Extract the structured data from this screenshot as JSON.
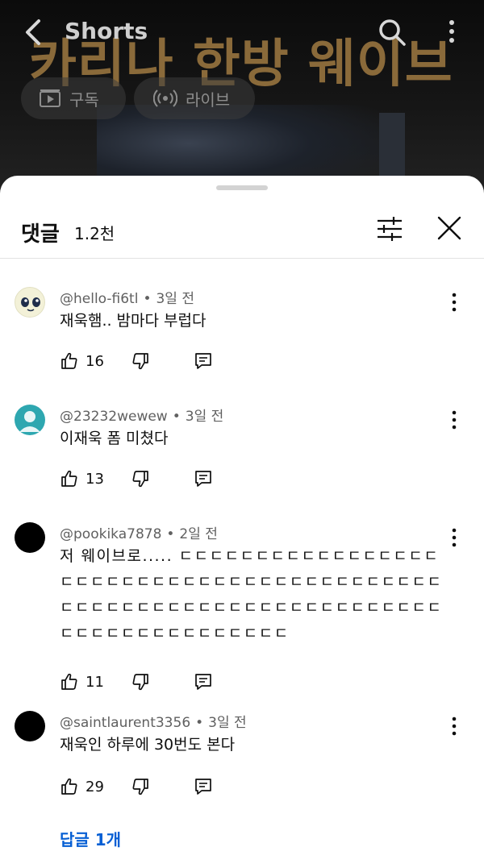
{
  "video": {
    "overlay_title": "카리나 한방 웨이브"
  },
  "topbar": {
    "title": "Shorts",
    "back_icon": "chevron-left-icon",
    "search_icon": "search-icon",
    "more_icon": "more-vert-icon"
  },
  "chips": {
    "subscribe_label": "구독",
    "live_label": "라이브"
  },
  "comments_sheet": {
    "title": "댓글",
    "count": "1.2천",
    "filter_icon": "filter-icon",
    "close_icon": "close-icon"
  },
  "comments": [
    {
      "author": "@hello-fi6tl",
      "time": "3일 전",
      "text": "재욱햄.. 밤마다 부럽다",
      "likes": "16"
    },
    {
      "author": "@23232wewew",
      "time": "3일 전",
      "text": "이재욱 폼 미쳤다",
      "likes": "13"
    },
    {
      "author": "@pookika7878",
      "time": "2일 전",
      "text": "저 웨이브로..... ㄷㄷㄷㄷㄷㄷㄷㄷㄷㄷㄷㄷㄷㄷㄷㄷㄷㄷㄷㄷㄷㄷㄷㄷㄷㄷㄷㄷㄷㄷㄷㄷㄷㄷㄷㄷㄷㄷㄷㄷㄷㄷㄷㄷㄷㄷㄷㄷㄷㄷㄷㄷㄷㄷㄷㄷㄷㄷㄷㄷㄷㄷㄷㄷㄷㄷㄷㄷㄷㄷㄷㄷㄷㄷㄷㄷㄷㄷㄷㄷㄷㄷ",
      "likes": "11"
    },
    {
      "author": "@saintlaurent3356",
      "time": "3일 전",
      "text": "재욱인 하루에 30번도 본다",
      "likes": "29"
    }
  ],
  "replies_link": "답글 1개",
  "colors": {
    "link_blue": "#065fd4",
    "overlay_gold": "#8a6a3a"
  }
}
